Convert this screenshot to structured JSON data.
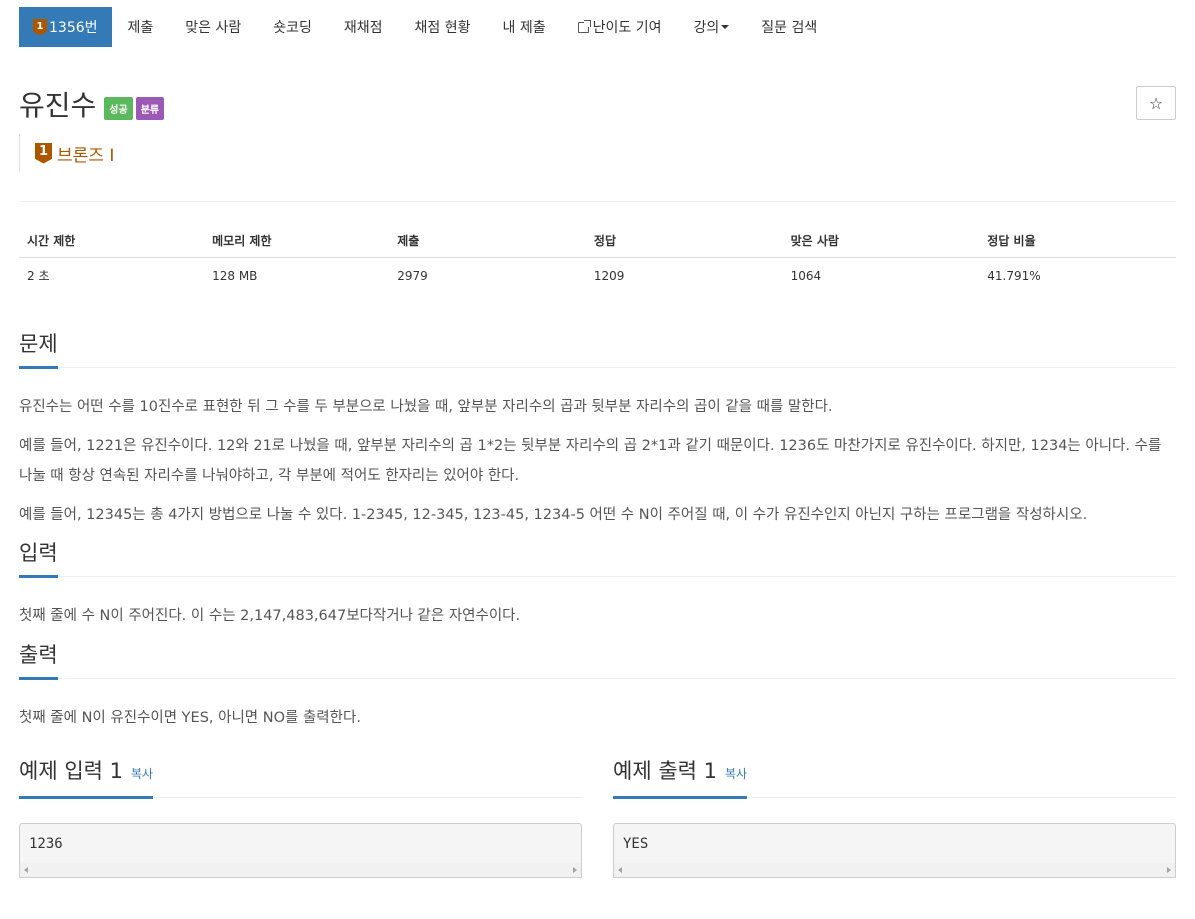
{
  "nav": {
    "problem_tier": "1",
    "problem_number": "1356번",
    "items": [
      {
        "label": "제출"
      },
      {
        "label": "맞은 사람"
      },
      {
        "label": "숏코딩"
      },
      {
        "label": "재채점"
      },
      {
        "label": "채점 현황"
      },
      {
        "label": "내 제출"
      },
      {
        "label": "난이도 기여"
      },
      {
        "label": "강의"
      },
      {
        "label": "질문 검색"
      }
    ]
  },
  "problem": {
    "title": "유진수",
    "label_success": "성공",
    "label_category": "분류",
    "star": "☆",
    "tier_number": "1",
    "tier_name": "브론즈 I"
  },
  "info": {
    "headers": [
      "시간 제한",
      "메모리 제한",
      "제출",
      "정답",
      "맞은 사람",
      "정답 비율"
    ],
    "values": [
      "2 초",
      "128 MB",
      "2979",
      "1209",
      "1064",
      "41.791%"
    ]
  },
  "description": {
    "heading": "문제",
    "paragraphs": [
      "유진수는 어떤 수를 10진수로 표현한 뒤 그 수를 두 부분으로 나눴을 때, 앞부분 자리수의 곱과 뒷부분 자리수의 곱이 같을 때를 말한다.",
      "예를 들어, 1221은 유진수이다. 12와 21로 나눴을 때, 앞부분 자리수의 곱 1*2는 뒷부분 자리수의 곱 2*1과 같기 때문이다. 1236도 마찬가지로 유진수이다. 하지만, 1234는 아니다. 수를 나눌 때 항상 연속된 자리수를 나눠야하고, 각 부분에 적어도 한자리는 있어야 한다.",
      "예를 들어, 12345는 총 4가지 방법으로 나눌 수 있다. 1-2345, 12-345, 123-45, 1234-5 어떤 수 N이 주어질 때, 이 수가 유진수인지 아닌지 구하는 프로그램을 작성하시오."
    ]
  },
  "input": {
    "heading": "입력",
    "text": "첫째 줄에 수 N이 주어진다. 이 수는 2,147,483,647보다작거나 같은 자연수이다."
  },
  "output": {
    "heading": "출력",
    "text": "첫째 줄에 N이 유진수이면 YES, 아니면 NO를 출력한다."
  },
  "samples": {
    "input_heading": "예제 입력 1",
    "output_heading": "예제 출력 1",
    "copy_label": "복사",
    "input_value": "1236",
    "output_value": "YES"
  }
}
